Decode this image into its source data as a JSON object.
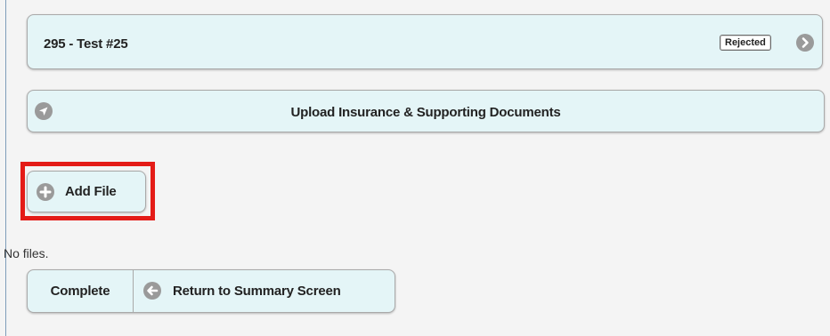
{
  "record": {
    "title": "295 - Test #25",
    "status": "Rejected",
    "arrow_icon": "chevron-right-icon"
  },
  "upload_section": {
    "title": "Upload Insurance & Supporting Documents",
    "icon": "navigation-arrow-icon"
  },
  "add_file": {
    "label": "Add File",
    "icon": "plus-icon",
    "highlight_color": "#e41b17"
  },
  "files": {
    "empty_message": "No files."
  },
  "actions": {
    "complete_label": "Complete",
    "return_label": "Return to Summary Screen",
    "return_icon": "arrow-left-icon"
  },
  "colors": {
    "panel_background": "#e4f5f7",
    "page_background": "#f4f4f4",
    "icon_gray": "#9a9a9a"
  }
}
